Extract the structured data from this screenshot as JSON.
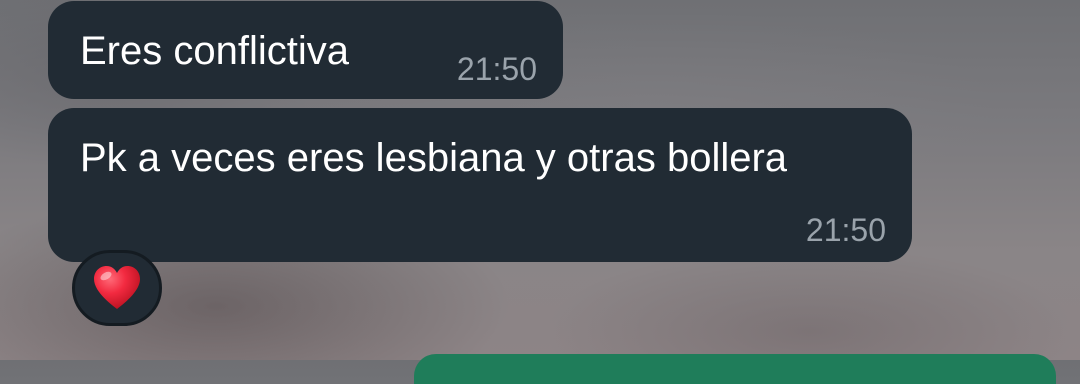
{
  "chat": {
    "messages": [
      {
        "text": "Eres conflictiva",
        "time": "21:50"
      },
      {
        "text": "Pk a veces eres lesbiana y otras bollera",
        "time": "21:50",
        "reaction": {
          "icon": "red-heart-icon",
          "color": "#e8263c"
        }
      }
    ]
  },
  "colors": {
    "incoming_bubble": "#212b34",
    "timestamp": "#9aa3ab",
    "outgoing_bubble_edge": "#1f7d5a"
  }
}
